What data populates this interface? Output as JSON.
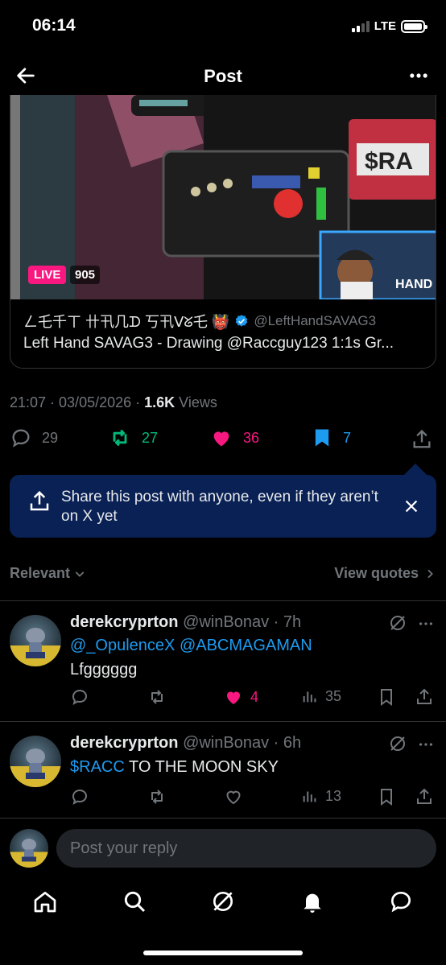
{
  "status_bar": {
    "time": "06:14",
    "network": "LTE"
  },
  "header": {
    "title": "Post"
  },
  "card": {
    "live_label": "LIVE",
    "viewer_count": "905",
    "author_name": "ㄥ乇千ㄒ 卄卂几ᗪ 丂卂ᐯᘜ乇 👹",
    "author_handle": "@LeftHandSAVAG3",
    "title": "Left Hand SAVAG3 - Drawing @Raccguy123 1:1s Gr..."
  },
  "meta": {
    "timestamp": "21:07 · 03/05/2026 · ",
    "views_count": "1.6K",
    "views_label": " Views"
  },
  "actions": {
    "replies": "29",
    "reposts": "27",
    "likes": "36",
    "bookmarks": "7"
  },
  "colors": {
    "repost": "#00ba7c",
    "like": "#f91880",
    "bookmark": "#1d9bf0",
    "tip_bg": "#0a2155"
  },
  "share_tip": {
    "text": "Share this post with anyone, even if they aren’t on X yet"
  },
  "filters": {
    "sort_label": "Relevant",
    "quotes_label": "View quotes"
  },
  "replies": [
    {
      "name": "derekcryprton",
      "handle": "@winBonav",
      "time": "· 7h",
      "mentions": "@_OpulenceX @ABCMAGAMAN",
      "text": "Lfgggggg",
      "reposts": "",
      "likes": "4",
      "views": "35"
    },
    {
      "name": "derekcryprton",
      "handle": "@winBonav",
      "time": "· 6h",
      "cashtag": "$RACC",
      "text": " TO THE MOON SKY",
      "likes": "",
      "views": "13"
    }
  ],
  "composer": {
    "placeholder": "Post your reply"
  }
}
